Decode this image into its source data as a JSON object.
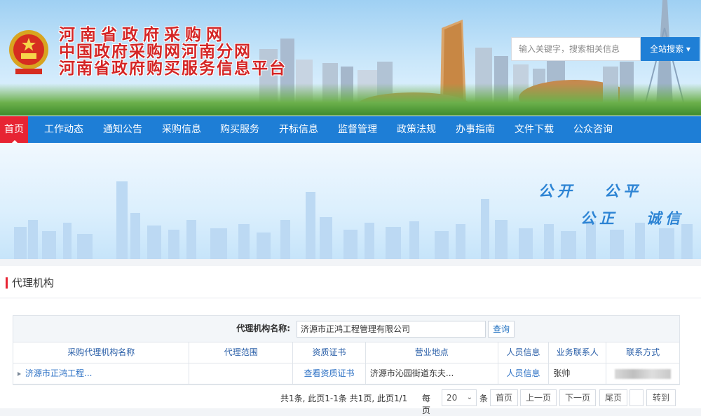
{
  "header": {
    "titles": [
      "河南省政府采购网",
      "中国政府采购网河南分网",
      "河南省政府购买服务信息平台"
    ],
    "search_placeholder": "输入关键字，搜索相关信息",
    "search_button": "全站搜索",
    "search_caret": "▾"
  },
  "nav": {
    "items": [
      "首页",
      "工作动态",
      "通知公告",
      "采购信息",
      "购买服务",
      "开标信息",
      "监督管理",
      "政策法规",
      "办事指南",
      "文件下载",
      "公众咨询"
    ]
  },
  "banner": {
    "slogans": [
      "公开",
      "公平",
      "公正",
      "诚信"
    ]
  },
  "section": {
    "title": "代理机构"
  },
  "query": {
    "label": "代理机构名称:",
    "value": "济源市正鸿工程管理有限公司",
    "button": "查询"
  },
  "table": {
    "headers": [
      "采购代理机构名称",
      "代理范围",
      "资质证书",
      "营业地点",
      "人员信息",
      "业务联系人",
      "联系方式"
    ],
    "rows": [
      {
        "name": "济源市正鸿工程...",
        "scope": "",
        "cert": "查看资质证书",
        "location": "济源市沁园街道东夫...",
        "staff": "人员信息",
        "contact": "张帅",
        "phone": ""
      }
    ]
  },
  "pager": {
    "summary": "共1条, 此页1-1条 共1页, 此页1/1",
    "per_page_label": "每页",
    "per_page_value": "20",
    "per_page_unit": "条",
    "first": "首页",
    "prev": "上一页",
    "next": "下一页",
    "last": "尾页",
    "goto": "转到"
  },
  "colors": {
    "nav_bg": "#1e7ed6",
    "nav_active": "#e72433",
    "title_red": "#d42525",
    "link_blue": "#2a6fc4"
  }
}
